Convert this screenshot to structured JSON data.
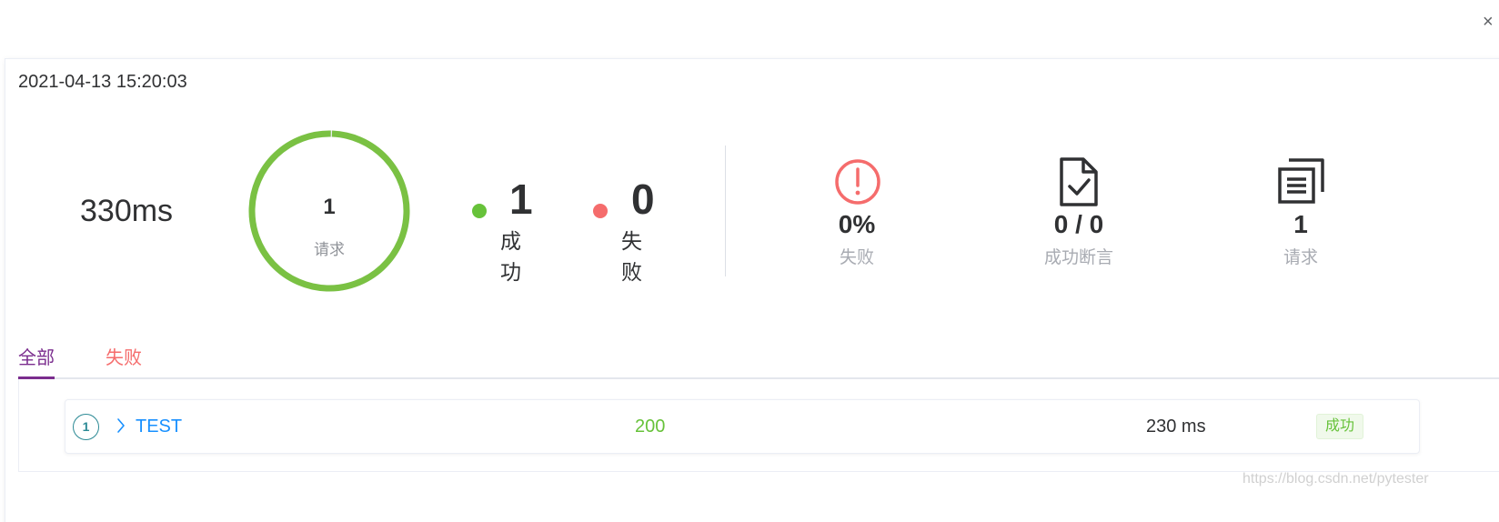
{
  "close_label": "×",
  "report": {
    "start_time": "2021-04-13 15:20:03",
    "duration": "330ms",
    "donut": {
      "count": "1",
      "label": "请求",
      "success_fraction": 1.0,
      "color": "#7ac143"
    },
    "success": {
      "count": "1",
      "label": "成功",
      "color": "#67c23a"
    },
    "fail": {
      "count": "0",
      "label": "失败",
      "color": "#f56c6c"
    },
    "metrics": [
      {
        "icon": "alert-circle-icon",
        "value": "0%",
        "label": "失败"
      },
      {
        "icon": "document-check-icon",
        "value": "0 / 0",
        "label": "成功断言"
      },
      {
        "icon": "copy-documents-icon",
        "value": "1",
        "label": "请求"
      }
    ]
  },
  "tabs": [
    {
      "label": "全部",
      "active": true
    },
    {
      "label": "失败",
      "active": false
    }
  ],
  "results": [
    {
      "index": "1",
      "name": "TEST",
      "status_code": "200",
      "time": "230 ms",
      "result": "成功"
    }
  ],
  "watermark": "https://blog.csdn.net/pytester"
}
